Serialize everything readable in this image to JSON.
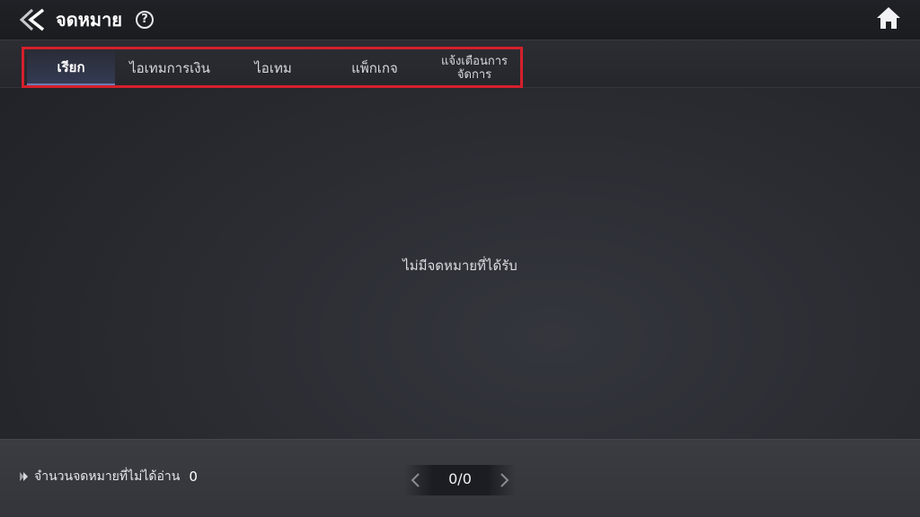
{
  "header": {
    "title": "จดหมาย",
    "help_label": "?",
    "back_icon": "double-chevron-left-icon",
    "home_icon": "home-icon"
  },
  "tabs": [
    {
      "label": "เรียก",
      "active": true
    },
    {
      "label": "ไอเทมการเงิน",
      "active": false
    },
    {
      "label": "ไอเทม",
      "active": false
    },
    {
      "label": "แพ็กเกจ",
      "active": false
    },
    {
      "label_line1": "แจ้งเตือนการ",
      "label_line2": "จัดการ",
      "active": false
    }
  ],
  "main": {
    "empty_message": "ไม่มีจดหมายที่ได้รับ"
  },
  "footer": {
    "unread_label": "จำนวนจดหมายที่ไม่ได้อ่าน",
    "unread_count": "0",
    "pager_label": "0/0"
  },
  "colors": {
    "highlight_border": "#d4202c",
    "active_tab_underline": "#6d7bb0"
  }
}
